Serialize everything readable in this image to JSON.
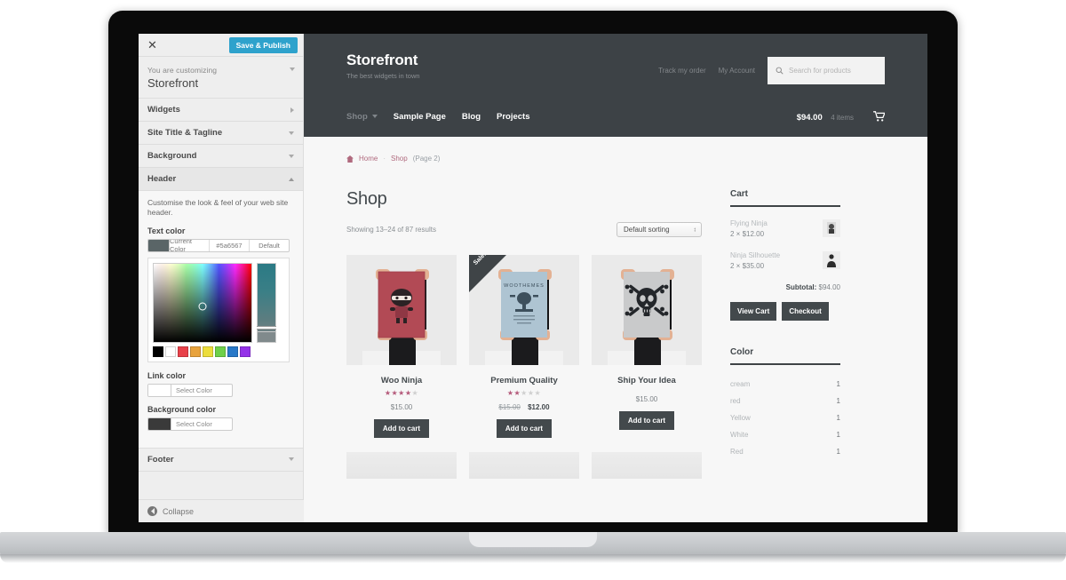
{
  "customizer": {
    "close_icon": "close-icon",
    "save_label": "Save & Publish",
    "intro_label": "You are customizing",
    "intro_title": "Storefront",
    "sections": [
      {
        "label": "Widgets",
        "state": "collapsed"
      },
      {
        "label": "Site Title & Tagline",
        "state": "collapsed"
      },
      {
        "label": "Background",
        "state": "collapsed"
      },
      {
        "label": "Header",
        "state": "expanded"
      }
    ],
    "header_panel": {
      "description": "Customise the look & feel of your web site header.",
      "text_color": {
        "label": "Text color",
        "current_label": "Current Color",
        "hex": "#5a6567",
        "default_label": "Default",
        "swatch": "#5a6567"
      },
      "palette": [
        "#000000",
        "#ffffff",
        "#e8414a",
        "#e8a33d",
        "#ecdd3c",
        "#6ed04a",
        "#2878c8",
        "#9432e8"
      ],
      "link_color": {
        "label": "Link color",
        "button_label": "Select Color",
        "swatch": "#ffffff"
      },
      "background_color": {
        "label": "Background color",
        "button_label": "Select Color",
        "swatch": "#3a3a3a"
      }
    },
    "footer_section": {
      "label": "Footer",
      "state": "collapsed"
    },
    "collapse_label": "Collapse",
    "accent_color": "#2ea2cc"
  },
  "site": {
    "title": "Storefront",
    "tagline": "The best widgets in town",
    "header_links": [
      "Track my order",
      "My Account"
    ],
    "search_placeholder": "Search for products",
    "search_icon": "search-icon",
    "nav": [
      {
        "label": "Shop",
        "active": true,
        "has_dropdown": true
      },
      {
        "label": "Sample Page",
        "active": false,
        "has_dropdown": false
      },
      {
        "label": "Blog",
        "active": false,
        "has_dropdown": false
      },
      {
        "label": "Projects",
        "active": false,
        "has_dropdown": false
      }
    ],
    "cart_total": "$94.00",
    "cart_items_label": "4 items",
    "cart_icon": "shopping-cart-icon",
    "header_bg": "#3d4246"
  },
  "breadcrumb": {
    "home_icon": "home-icon",
    "home": "Home",
    "separator": "·",
    "current": "Shop",
    "page": "(Page 2)"
  },
  "shop": {
    "title": "Shop",
    "results": "Showing 13–24 of 87 results",
    "sorting_selected": "Default sorting",
    "products": [
      {
        "name": "Woo Ninja",
        "rating": 4,
        "rating_max": 5,
        "price": "$15.00",
        "on_sale": false,
        "button": "Add to cart",
        "image": "person-holding-red-ninja-poster"
      },
      {
        "name": "Premium Quality",
        "rating": 2,
        "rating_max": 5,
        "price_old": "$15.00",
        "price": "$12.00",
        "on_sale": true,
        "sale_badge": "Sale!",
        "button": "Add to cart",
        "image": "person-holding-blue-woothemes-poster"
      },
      {
        "name": "Ship Your Idea",
        "rating": 0,
        "rating_max": 5,
        "price": "$15.00",
        "on_sale": false,
        "button": "Add to cart",
        "image": "person-holding-grey-skull-poster"
      }
    ]
  },
  "cart_widget": {
    "title": "Cart",
    "items": [
      {
        "name": "Flying Ninja",
        "qty_price": "2 × $12.00",
        "thumb": "flying-ninja-thumb"
      },
      {
        "name": "Ninja Silhouette",
        "qty_price": "2 × $35.00",
        "thumb": "ninja-silhouette-thumb"
      }
    ],
    "subtotal_label": "Subtotal:",
    "subtotal_value": "$94.00",
    "view_cart": "View Cart",
    "checkout": "Checkout"
  },
  "color_widget": {
    "title": "Color",
    "items": [
      {
        "label": "cream",
        "count": "1"
      },
      {
        "label": "red",
        "count": "1"
      },
      {
        "label": "Yellow",
        "count": "1"
      },
      {
        "label": "White",
        "count": "1"
      },
      {
        "label": "Red",
        "count": "1"
      }
    ]
  }
}
